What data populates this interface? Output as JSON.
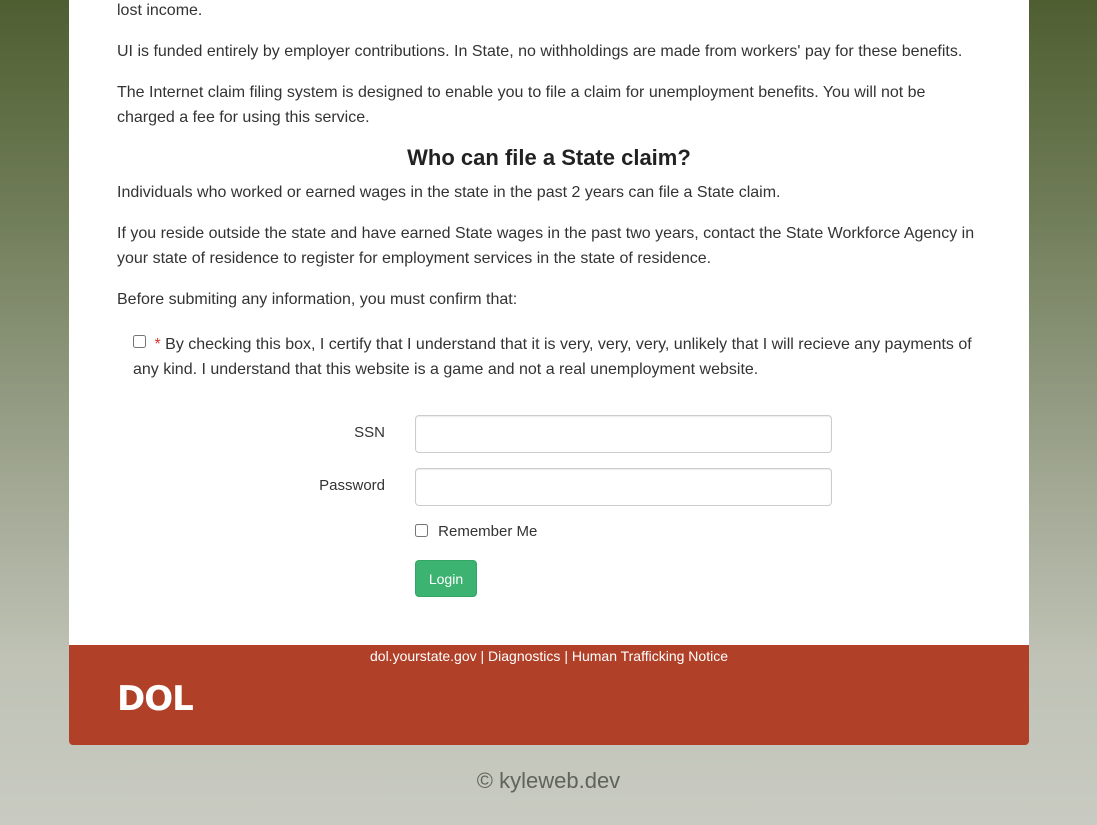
{
  "intro": {
    "lost_income": "lost income.",
    "ui_funding": "UI is funded entirely by employer contributions. In State, no withholdings are made from workers' pay for these benefits.",
    "internet_system": "The Internet claim filing system is designed to enable you to file a claim for unemployment benefits. You will not be charged a fee for using this service."
  },
  "who": {
    "heading": "Who can file a State claim?",
    "individuals": "Individuals who worked or earned wages in the state in the past 2 years can file a State claim.",
    "reside_outside": "If you reside outside the state and have earned State wages in the past two years, contact the State Workforce Agency in your state of residence to register for employment services in the state of residence.",
    "before_submit": "Before submiting any information, you must confirm that:"
  },
  "certify": {
    "required_mark": "*",
    "text": "By checking this box, I certify that I understand that it is very, very, very, unlikely that I will recieve any payments of any kind. I understand that this website is a game and not a real unemployment website.",
    "checked": false
  },
  "login_form": {
    "ssn_label": "SSN",
    "ssn_value": "",
    "password_label": "Password",
    "password_value": "",
    "remember_label": "Remember Me",
    "remember_checked": false,
    "login_button": "Login"
  },
  "footer": {
    "links": [
      "dol.yourstate.gov",
      "Diagnostics",
      "Human Trafficking Notice"
    ],
    "separator": "|",
    "logo_text": "DOL"
  },
  "copyright": "© kyleweb.dev",
  "colors": {
    "footer_bg": "#b04128",
    "login_button": "#3cb371",
    "required": "#d9322f"
  }
}
